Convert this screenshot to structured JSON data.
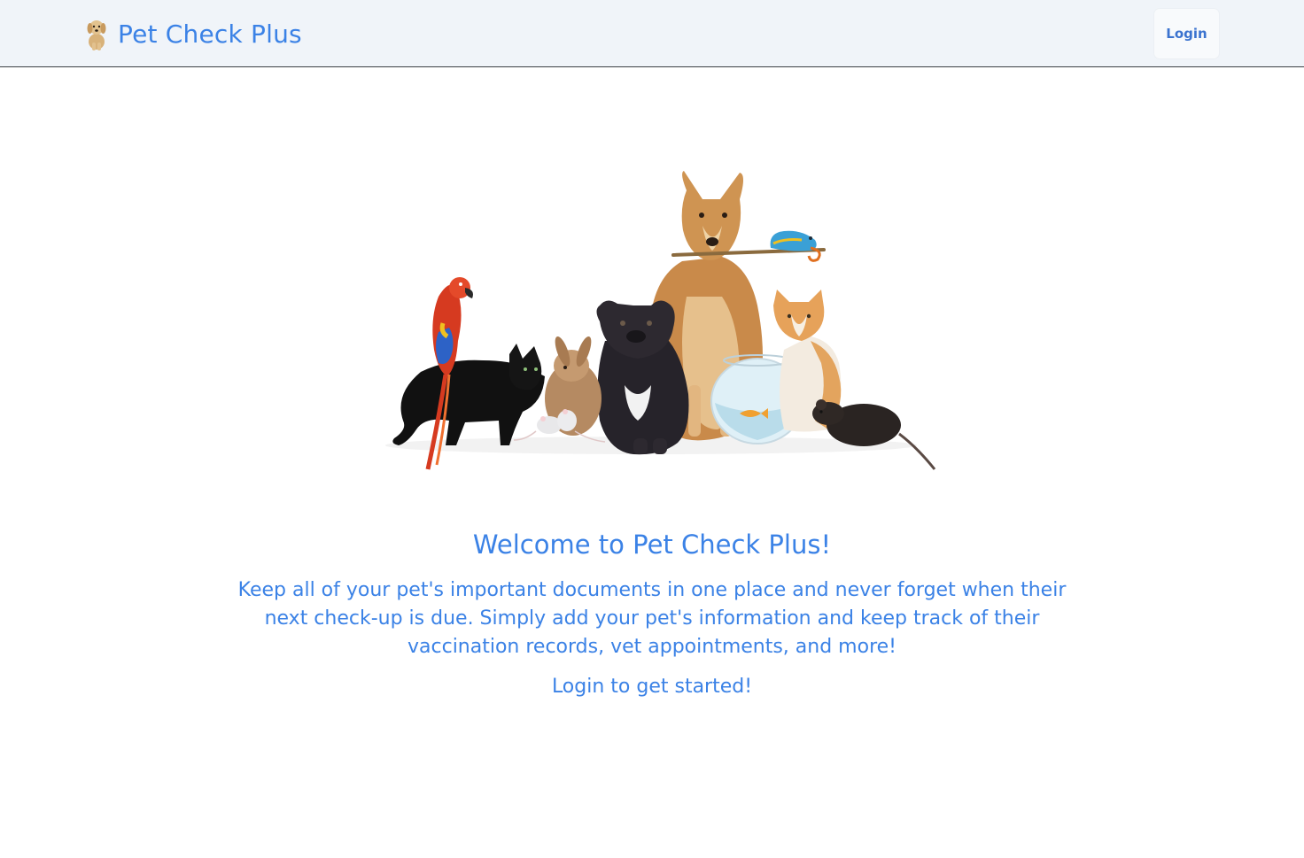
{
  "navbar": {
    "brand_title": "Pet Check Plus",
    "logo_icon": "puppy-icon",
    "login_label": "Login"
  },
  "hero": {
    "image_icon": "pet-group-illustration"
  },
  "main": {
    "welcome_heading": "Welcome to Pet Check Plus!",
    "description": "Keep all of your pet's important documents in one place and never forget when their next check-up is due. Simply add your pet's information and keep track of their vaccination records, vet appointments, and more!",
    "cta_text": "Login to get started!"
  },
  "colors": {
    "accent": "#3b82e6",
    "navbar_bg": "#f0f4f9"
  }
}
